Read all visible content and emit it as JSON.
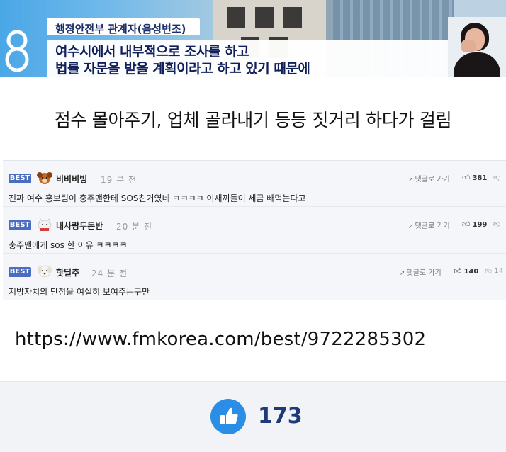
{
  "broadcast": {
    "speaker": "행정안전부 관계자(음성변조)",
    "caption_lines": [
      "여수시에서 내부적으로 조사를 하고",
      "법률 자문을 받을 계획이라고 하고 있기 때문에"
    ],
    "channel_logo": "8"
  },
  "main_caption": "점수 몰아주기, 업체 골라내기 등등 짓거리 하다가 걸림",
  "comments": [
    {
      "badge": "BEST",
      "avatar": "dog-avatar-icon",
      "nickname": "비비비빙",
      "time": "19 분 전",
      "goto": "댓글로 가기",
      "likes": "381",
      "dislikes": "",
      "text": "진짜 여수 홍보팀이 충주맨한테 SOS친거였네 ㅋㅋㅋㅋ 이새끼들이 세금 빼먹는다고"
    },
    {
      "badge": "BEST",
      "avatar": "cat-avatar-icon",
      "nickname": "내사랑두돈반",
      "time": "20 분 전",
      "goto": "댓글로 가기",
      "likes": "199",
      "dislikes": "",
      "text": "충주맨에게 sos 한 이유 ㅋㅋㅋㅋ"
    },
    {
      "badge": "BEST",
      "avatar": "white-dog-avatar-icon",
      "nickname": "핫딜추",
      "time": "24 분 전",
      "goto": "댓글로 가기",
      "likes": "140",
      "dislikes": "14",
      "text": "지방자치의 단점을 여실히 보여주는구만"
    }
  ],
  "source_link": "https://www.fmkorea.com/best/9722285302",
  "like_bar": {
    "count": "173",
    "icon": "thumbs-up-icon",
    "accent_color": "#2a8ee6"
  }
}
